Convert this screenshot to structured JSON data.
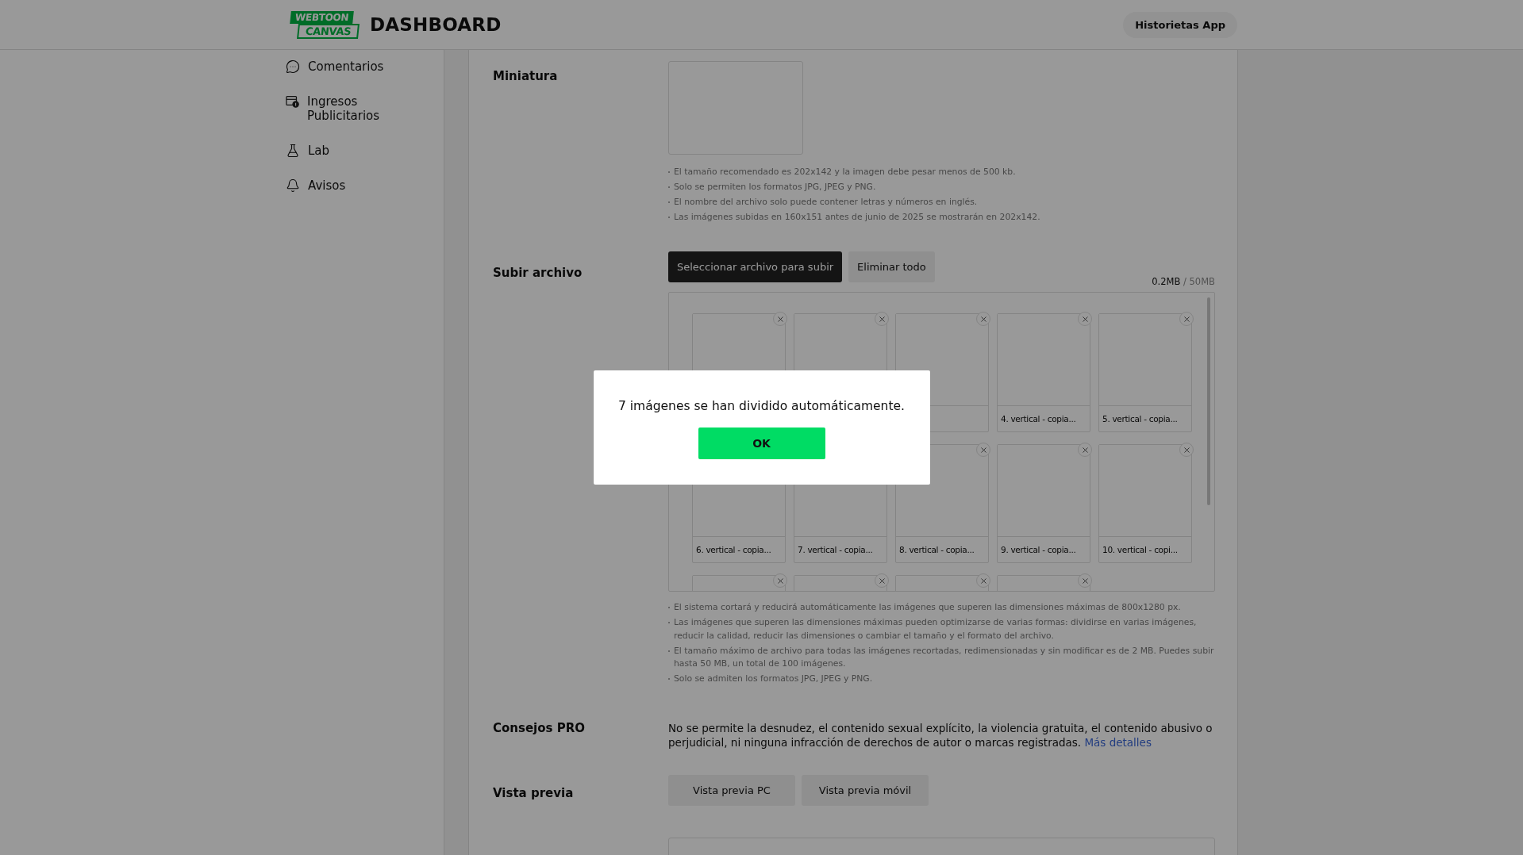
{
  "header": {
    "logo": {
      "line1": "WEBTOON",
      "line2": "CANVAS"
    },
    "title": "DASHBOARD",
    "app_button": "Historietas App"
  },
  "sidebar": {
    "items": [
      {
        "kind": "comments",
        "label": "Comentarios"
      },
      {
        "kind": "revenue",
        "label": "Ingresos Publicitarios"
      },
      {
        "kind": "lab",
        "label": "Lab"
      },
      {
        "kind": "notices",
        "label": "Avisos"
      }
    ]
  },
  "thumbnail": {
    "label": "Miniatura",
    "notes": [
      "El tamaño recomendado es 202x142 y la imagen debe pesar menos de 500 kb.",
      "Solo se permiten los formatos JPG, JPEG y PNG.",
      "El nombre del archivo solo puede contener letras y números en inglés.",
      "Las imágenes subidas en 160x151 antes de junio de 2025 se mostrarán en 202x142."
    ]
  },
  "upload": {
    "label": "Subir archivo",
    "select_button": "Seleccionar archivo para subir",
    "delete_all_button": "Eliminar todo",
    "usage": {
      "used": "0.2MB",
      "total": "/ 50MB"
    },
    "files": [
      {
        "kind": "blank"
      },
      {
        "kind": "blank"
      },
      {
        "kind": "blank"
      },
      {
        "kind": "captioned",
        "caption": "4. vertical - copia..."
      },
      {
        "kind": "captioned",
        "caption": "5. vertical - copia..."
      },
      {
        "kind": "captioned",
        "caption": "6. vertical - copia..."
      },
      {
        "kind": "captioned",
        "caption": "7. vertical - copia..."
      },
      {
        "kind": "captioned",
        "caption": "8. vertical - copia..."
      },
      {
        "kind": "captioned",
        "caption": "9. vertical - copia..."
      },
      {
        "kind": "captioned",
        "caption": "10. vertical - copi..."
      },
      {
        "kind": "blank"
      },
      {
        "kind": "blank"
      },
      {
        "kind": "blank"
      },
      {
        "kind": "blank"
      }
    ],
    "notes": [
      "El sistema cortará y reducirá automáticamente las imágenes que superen las dimensiones máximas de 800x1280 px.",
      "Las imágenes que superen las dimensiones máximas pueden optimizarse de varias formas: dividirse en varias imágenes, reducir la calidad, reducir las dimensiones o cambiar el tamaño y el formato del archivo.",
      "El tamaño máximo de archivo para todas las imágenes recortadas, redimensionadas y sin modificar es de 2 MB. Puedes subir hasta 50 MB, un total de 100 imágenes.",
      "Solo se admiten los formatos JPG, JPEG y PNG."
    ]
  },
  "pro_tips": {
    "label": "Consejos PRO",
    "text": "No se permite la desnudez, el contenido sexual explícito, la violencia gratuita, el contenido abusivo o perjudicial, ni ninguna infracción de derechos de autor o marcas registradas.",
    "link": "Más detalles"
  },
  "preview": {
    "label": "Vista previa",
    "buttons": [
      "Vista previa PC",
      "Vista previa móvil"
    ]
  },
  "modal": {
    "message": "7 imágenes se han dividido automáticamente.",
    "ok_button": "OK"
  }
}
